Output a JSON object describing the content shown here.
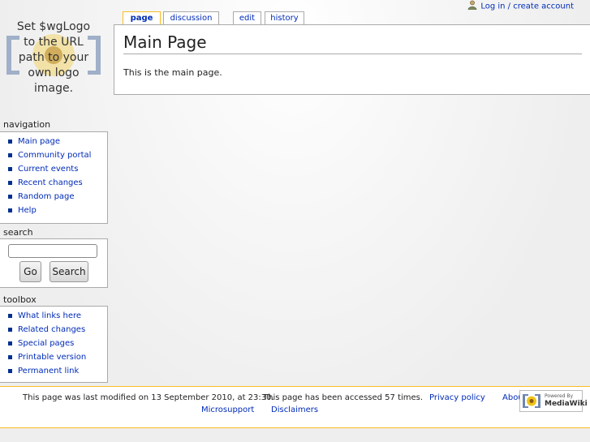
{
  "logo": {
    "lines": [
      "Set $wgLogo",
      "to the URL",
      "path to your",
      "own logo",
      "image."
    ]
  },
  "personal": {
    "login_label": "Log in / create account",
    "icon": "user-icon"
  },
  "tabs": [
    {
      "label": "page",
      "selected": true
    },
    {
      "label": "discussion",
      "selected": false
    },
    {
      "label": "edit",
      "selected": false
    },
    {
      "label": "history",
      "selected": false
    }
  ],
  "content": {
    "heading": "Main Page",
    "body": "This is the main page."
  },
  "navigation": {
    "title": "navigation",
    "items": [
      "Main page",
      "Community portal",
      "Current events",
      "Recent changes",
      "Random page",
      "Help"
    ]
  },
  "search": {
    "title": "search",
    "input_value": "",
    "go_label": "Go",
    "search_label": "Search"
  },
  "toolbox": {
    "title": "toolbox",
    "items": [
      "What links here",
      "Related changes",
      "Special pages",
      "Printable version",
      "Permanent link"
    ]
  },
  "footer": {
    "lastmod": "This page was last modified on 13 September 2010, at 23:30.",
    "accessed": "This page has been accessed 57 times.",
    "privacy": "Privacy policy",
    "about": "Abou",
    "microsupport": "Microsupport",
    "disclaimers": "Disclaimers",
    "powered_top": "Powered By",
    "powered_bottom": "MediaWiki"
  },
  "colors": {
    "link": "#002bb8",
    "tab_selected_border": "#fabd23",
    "border": "#aaaaaa",
    "bullet": "#00308f"
  }
}
